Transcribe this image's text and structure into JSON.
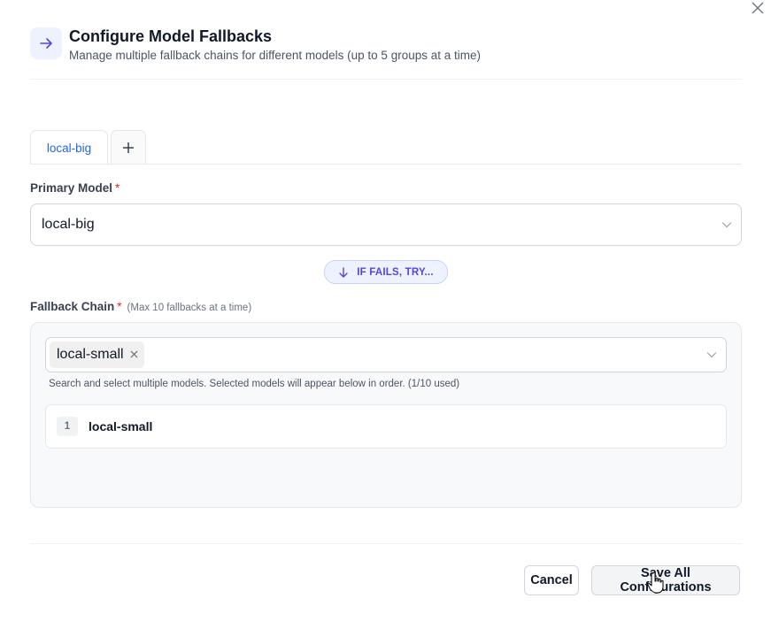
{
  "dialog": {
    "title": "Configure Model Fallbacks",
    "subtitle": "Manage multiple fallback chains for different models (up to 5 groups at a time)"
  },
  "tabs": [
    {
      "label": "local-big",
      "active": true
    }
  ],
  "primary_model": {
    "label": "Primary Model",
    "required_mark": "*",
    "selected_value": "local-big"
  },
  "divider_pill": {
    "label": "IF FAILS, TRY..."
  },
  "fallback_chain": {
    "label": "Fallback Chain",
    "required_mark": "*",
    "hint": "(Max 10 fallbacks at a time)",
    "selected_tags": [
      "local-small"
    ],
    "helper_text": "Search and select multiple models. Selected models will appear below in order. (1/10 used)",
    "ordered_items": [
      {
        "index": "1",
        "name": "local-small"
      }
    ]
  },
  "footer": {
    "cancel_label": "Cancel",
    "save_label": "Save All Configurations"
  },
  "colors": {
    "accent": "#4f46e5",
    "tab_active_text": "#2563eb",
    "required": "#dc2626"
  },
  "icons": {
    "close": "close-icon",
    "header": "arrow-right-icon",
    "add_tab": "plus-icon",
    "dropdown": "chevron-down-icon",
    "pill": "arrow-down-icon",
    "tag_remove": "close-icon",
    "cursor": "hand-pointer-icon"
  }
}
